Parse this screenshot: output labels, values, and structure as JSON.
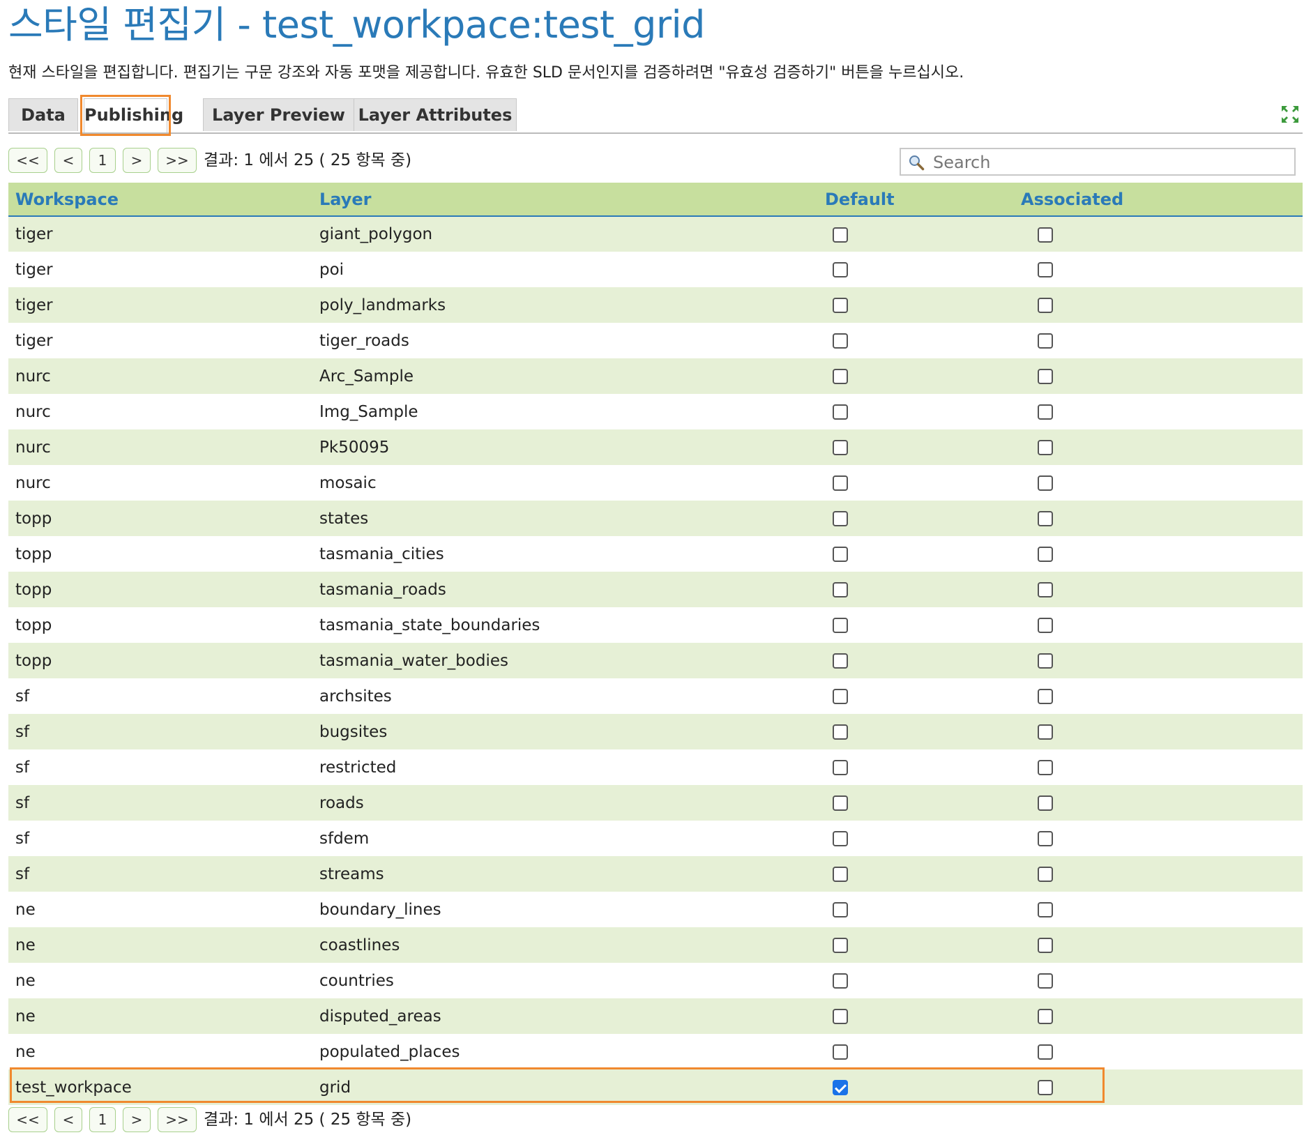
{
  "page": {
    "title": "스타일 편집기 - test_workpace:test_grid",
    "description": "현재 스타일을 편집합니다. 편집기는 구문 강조와 자동 포맷을 제공합니다. 유효한 SLD 문서인지를 검증하려면 \"유효성 검증하기\" 버튼을 누르십시오."
  },
  "tabs": [
    {
      "label": "Data",
      "active": false
    },
    {
      "label": "Publishing",
      "active": true
    },
    {
      "label": "Layer Preview",
      "active": false
    },
    {
      "label": "Layer Attributes",
      "active": false
    }
  ],
  "pager": {
    "first": "<<",
    "prev": "<",
    "page": "1",
    "next": ">",
    "last": ">>",
    "info": "결과: 1 에서 25 ( 25 항목 중)"
  },
  "search": {
    "placeholder": "Search"
  },
  "icons": {
    "search": "search-icon",
    "expand": "expand-icon"
  },
  "colors": {
    "title": "#2a7ab8",
    "header_bg": "#c7df9e",
    "row_alt_bg": "#e6f0d6",
    "highlight": "#f0892e",
    "checkbox_checked": "#1a73e8"
  },
  "table": {
    "columns": [
      "Workspace",
      "Layer",
      "Default",
      "Associated"
    ],
    "rows": [
      {
        "workspace": "tiger",
        "layer": "giant_polygon",
        "default": false,
        "associated": false
      },
      {
        "workspace": "tiger",
        "layer": "poi",
        "default": false,
        "associated": false
      },
      {
        "workspace": "tiger",
        "layer": "poly_landmarks",
        "default": false,
        "associated": false
      },
      {
        "workspace": "tiger",
        "layer": "tiger_roads",
        "default": false,
        "associated": false
      },
      {
        "workspace": "nurc",
        "layer": "Arc_Sample",
        "default": false,
        "associated": false
      },
      {
        "workspace": "nurc",
        "layer": "Img_Sample",
        "default": false,
        "associated": false
      },
      {
        "workspace": "nurc",
        "layer": "Pk50095",
        "default": false,
        "associated": false
      },
      {
        "workspace": "nurc",
        "layer": "mosaic",
        "default": false,
        "associated": false
      },
      {
        "workspace": "topp",
        "layer": "states",
        "default": false,
        "associated": false
      },
      {
        "workspace": "topp",
        "layer": "tasmania_cities",
        "default": false,
        "associated": false
      },
      {
        "workspace": "topp",
        "layer": "tasmania_roads",
        "default": false,
        "associated": false
      },
      {
        "workspace": "topp",
        "layer": "tasmania_state_boundaries",
        "default": false,
        "associated": false
      },
      {
        "workspace": "topp",
        "layer": "tasmania_water_bodies",
        "default": false,
        "associated": false
      },
      {
        "workspace": "sf",
        "layer": "archsites",
        "default": false,
        "associated": false
      },
      {
        "workspace": "sf",
        "layer": "bugsites",
        "default": false,
        "associated": false
      },
      {
        "workspace": "sf",
        "layer": "restricted",
        "default": false,
        "associated": false
      },
      {
        "workspace": "sf",
        "layer": "roads",
        "default": false,
        "associated": false
      },
      {
        "workspace": "sf",
        "layer": "sfdem",
        "default": false,
        "associated": false
      },
      {
        "workspace": "sf",
        "layer": "streams",
        "default": false,
        "associated": false
      },
      {
        "workspace": "ne",
        "layer": "boundary_lines",
        "default": false,
        "associated": false
      },
      {
        "workspace": "ne",
        "layer": "coastlines",
        "default": false,
        "associated": false
      },
      {
        "workspace": "ne",
        "layer": "countries",
        "default": false,
        "associated": false
      },
      {
        "workspace": "ne",
        "layer": "disputed_areas",
        "default": false,
        "associated": false
      },
      {
        "workspace": "ne",
        "layer": "populated_places",
        "default": false,
        "associated": false
      },
      {
        "workspace": "test_workpace",
        "layer": "grid",
        "default": true,
        "associated": false
      }
    ]
  }
}
